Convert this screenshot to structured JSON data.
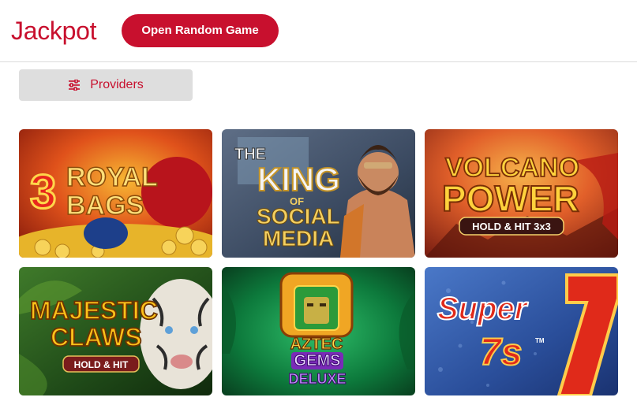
{
  "header": {
    "title": "Jackpot",
    "random_button_label": "Open Random Game"
  },
  "filters": {
    "providers_label": "Providers",
    "providers_icon": "sliders-icon"
  },
  "colors": {
    "brand_red": "#c8102e",
    "button_grey": "#dedede"
  },
  "games": [
    {
      "lines": [
        "3",
        "ROYAL",
        "BAGS"
      ]
    },
    {
      "lines": [
        "THE",
        "KING",
        "OF",
        "SOCIAL",
        "MEDIA"
      ]
    },
    {
      "lines": [
        "VOLCANO",
        "POWER",
        "HOLD & HIT 3x3"
      ]
    },
    {
      "lines": [
        "MAJESTIC",
        "CLAWS",
        "HOLD & HIT"
      ]
    },
    {
      "lines": [
        "AZTEC",
        "GEMS",
        "DELUXE"
      ]
    },
    {
      "lines": [
        "Super",
        "7s",
        "TM"
      ]
    }
  ]
}
